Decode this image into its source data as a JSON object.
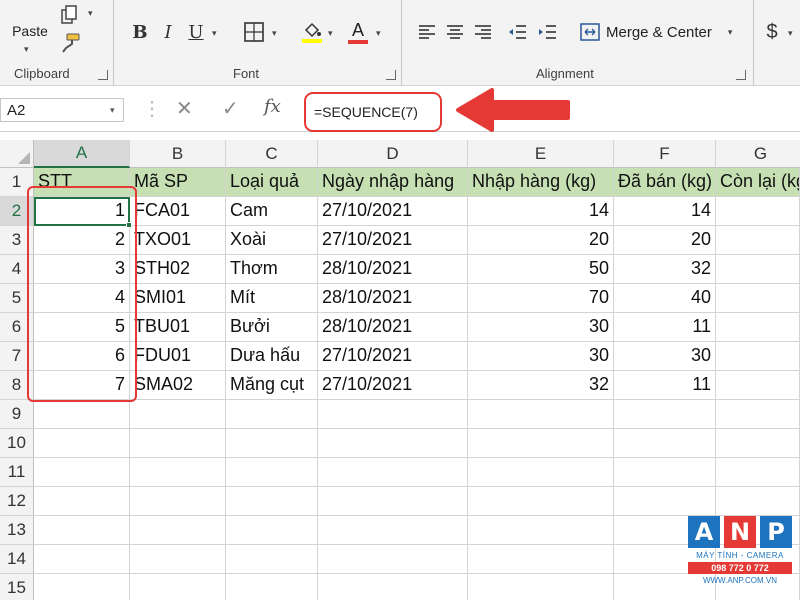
{
  "ribbon": {
    "clipboard": {
      "label": "Clipboard",
      "paste": "Paste"
    },
    "font": {
      "label": "Font",
      "bold": "B",
      "italic": "I",
      "underline": "U"
    },
    "alignment": {
      "label": "Alignment",
      "merge": "Merge & Center"
    },
    "number": {
      "currency": "$"
    },
    "font_color": "#e53935",
    "fill_color": "#ffff00"
  },
  "formula_bar": {
    "name_box": "A2",
    "fx": "fx",
    "formula": "=SEQUENCE(7)"
  },
  "grid": {
    "columns": [
      "A",
      "B",
      "C",
      "D",
      "E",
      "F",
      "G"
    ],
    "rows": [
      "1",
      "2",
      "3",
      "4",
      "5",
      "6",
      "7",
      "8",
      "9",
      "10",
      "11",
      "12",
      "13",
      "14",
      "15"
    ],
    "header": [
      "STT",
      "Mã SP",
      "Loại quả",
      "Ngày nhập hàng",
      "Nhập hàng (kg)",
      "Đã bán (kg)",
      "Còn lại (kg)"
    ],
    "data": [
      [
        "1",
        "FCA01",
        "Cam",
        "27/10/2021",
        "14",
        "14",
        ""
      ],
      [
        "2",
        "TXO01",
        "Xoài",
        "27/10/2021",
        "20",
        "20",
        ""
      ],
      [
        "3",
        "STH02",
        "Thơm",
        "28/10/2021",
        "50",
        "32",
        ""
      ],
      [
        "4",
        "SMI01",
        "Mít",
        "28/10/2021",
        "70",
        "40",
        ""
      ],
      [
        "5",
        "TBU01",
        "Bưởi",
        "28/10/2021",
        "30",
        "11",
        ""
      ],
      [
        "6",
        "FDU01",
        "Dưa hấu",
        "27/10/2021",
        "30",
        "30",
        ""
      ],
      [
        "7",
        "SMA02",
        "Măng cụt",
        "27/10/2021",
        "32",
        "11",
        ""
      ]
    ],
    "header_fill": "#c6e0b4",
    "selection_color": "#217346"
  },
  "annotation": {
    "color": "#e53935"
  },
  "logo": {
    "letters": [
      "A",
      "N",
      "P"
    ],
    "letter_colors": [
      "#1e73be",
      "#e53935",
      "#1e73be"
    ],
    "subtitle": "MÁY TÍNH - CAMERA",
    "phone": "098 772 0 772",
    "website": "WWW.ANP.COM.VN"
  }
}
